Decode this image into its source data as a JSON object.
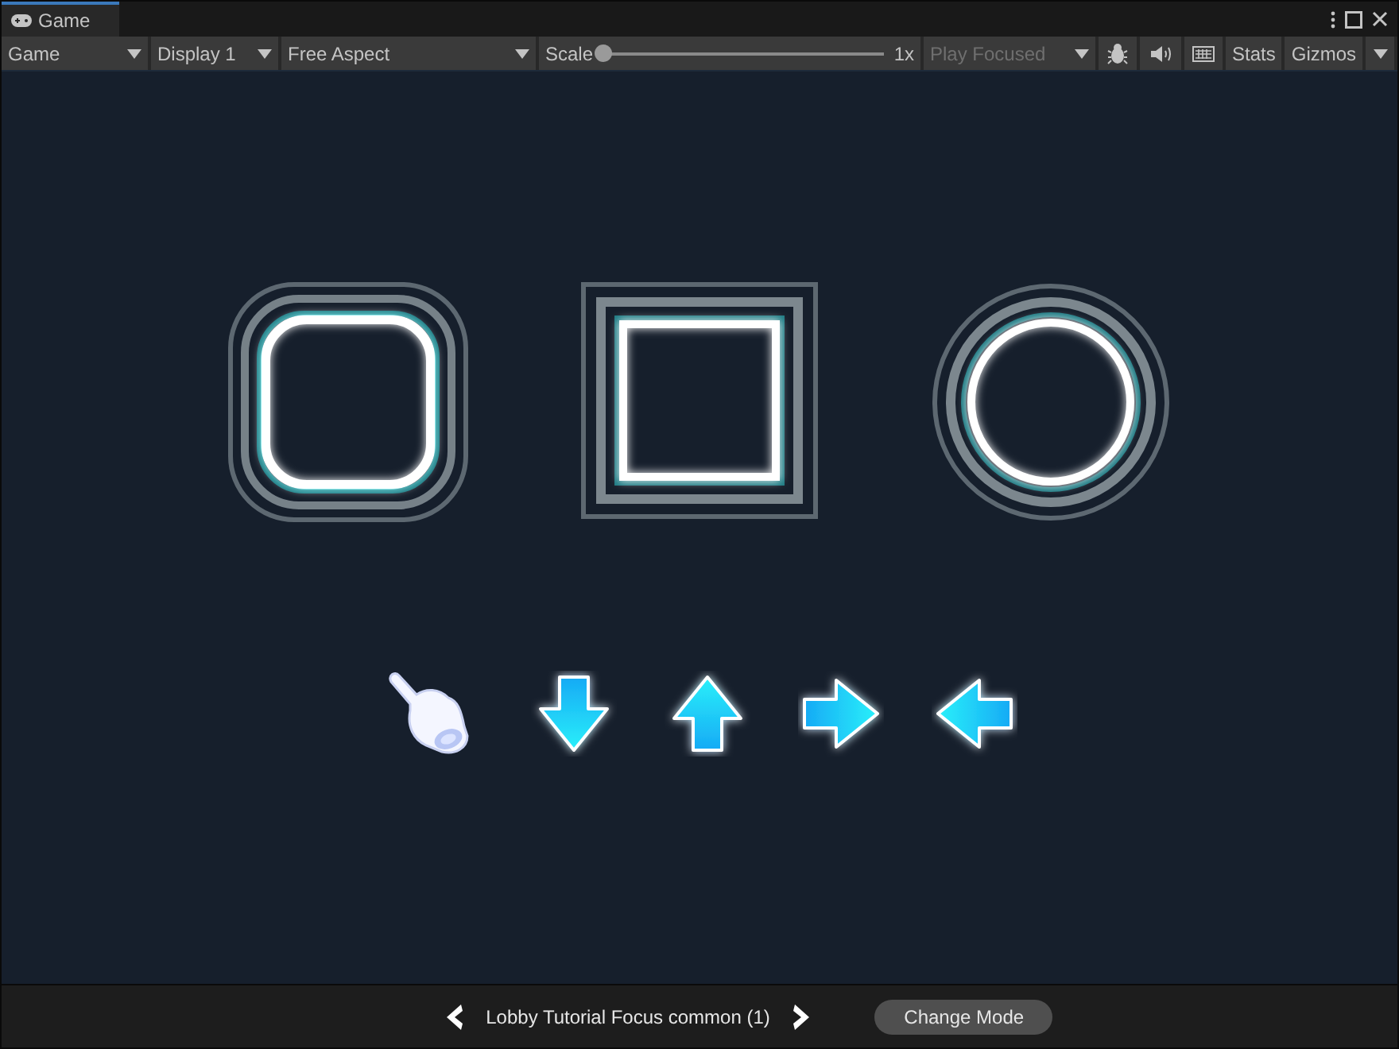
{
  "window": {
    "tab": "Game"
  },
  "toolbar": [
    {
      "kind": "dropdown",
      "label": "Game",
      "disabled": false
    },
    {
      "kind": "dropdown",
      "label": "Display 1",
      "disabled": false
    },
    {
      "kind": "dropdown",
      "label": "Free Aspect",
      "disabled": false
    },
    {
      "kind": "slider",
      "label": "Scale",
      "level": 0,
      "reading": "1x"
    },
    {
      "kind": "dropdown",
      "label": "Play Focused",
      "disabled": true
    },
    {
      "kind": "icon",
      "on": false
    },
    {
      "kind": "icon",
      "on": false
    },
    {
      "kind": "icon",
      "on": false
    },
    {
      "kind": "toggle",
      "label": "Stats",
      "on": false
    },
    {
      "kind": "split",
      "label": "Gizmos",
      "on": false
    }
  ],
  "shapes": [
    {
      "kind": "rounded"
    },
    {
      "kind": "square"
    },
    {
      "kind": "circle"
    }
  ],
  "inputs": [
    {
      "kind": "hand"
    },
    {
      "kind": "down"
    },
    {
      "kind": "up"
    },
    {
      "kind": "right"
    },
    {
      "kind": "left"
    }
  ],
  "footer": {
    "label": "Lobby Tutorial Focus common (1)",
    "button": "Change Mode"
  }
}
